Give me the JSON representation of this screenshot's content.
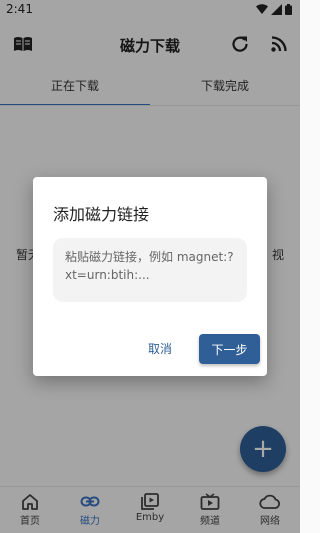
{
  "status_bar": {
    "time": "2:41"
  },
  "app_bar": {
    "title": "磁力下载",
    "icons": [
      "book-icon",
      "refresh-icon",
      "rss-icon"
    ]
  },
  "tabs": [
    {
      "label": "正在下载",
      "active": true
    },
    {
      "label": "下载完成",
      "active": false
    }
  ],
  "content": {
    "empty_left_fragment": "暂无",
    "empty_right_fragment": "视"
  },
  "fab": {
    "icon": "plus-icon",
    "label": "+"
  },
  "bottom_nav": [
    {
      "label": "首页",
      "icon": "home-icon",
      "active": false
    },
    {
      "label": "磁力",
      "icon": "link-icon",
      "active": true
    },
    {
      "label": "Emby",
      "icon": "play-box-icon",
      "active": false
    },
    {
      "label": "频道",
      "icon": "tv-icon",
      "active": false
    },
    {
      "label": "网络",
      "icon": "cloud-icon",
      "active": false
    }
  ],
  "dialog": {
    "title": "添加磁力链接",
    "input_placeholder": "粘贴磁力链接，例如 magnet:?xt=urn:btih:...",
    "cancel_label": "取消",
    "next_label": "下一步"
  },
  "colors": {
    "accent": "#3a73c2",
    "button": "#2f5f96",
    "scrim": "rgba(0,0,0,0.34)"
  }
}
